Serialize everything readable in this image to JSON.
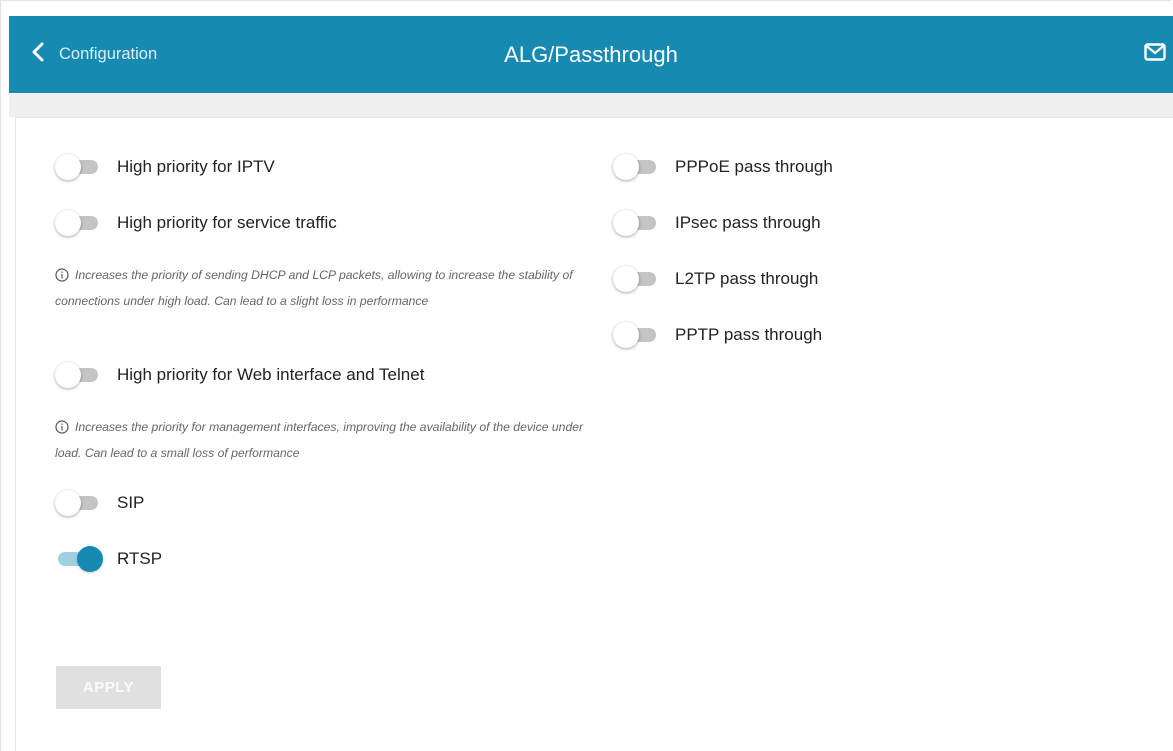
{
  "header": {
    "back_label": "Configuration",
    "title": "ALG/Passthrough",
    "mail_icon": "mail-icon",
    "back_icon": "chevron-left-icon",
    "color": "#178ab2"
  },
  "left_toggles": {
    "iptv": {
      "label": "High priority for IPTV",
      "on": false
    },
    "service": {
      "label": "High priority for service traffic",
      "on": false
    },
    "service_hint": "Increases the priority of sending DHCP and LCP packets, allowing to increase the stability of connections under high load. Can lead to a slight loss in performance",
    "web": {
      "label": "High priority for Web interface and Telnet",
      "on": false
    },
    "web_hint": "Increases the priority for management interfaces, improving the availability of the device under load. Can lead to a small loss of performance",
    "sip": {
      "label": "SIP",
      "on": false
    },
    "rtsp": {
      "label": "RTSP",
      "on": true
    }
  },
  "right_toggles": {
    "pppoe": {
      "label": "PPPoE pass through",
      "on": false
    },
    "ipsec": {
      "label": "IPsec pass through",
      "on": false
    },
    "l2tp": {
      "label": "L2TP pass through",
      "on": false
    },
    "pptp": {
      "label": "PPTP pass through",
      "on": false
    }
  },
  "apply_label": "APPLY",
  "colors": {
    "accent": "#178ab2",
    "toggle_on_track": "#9fd0e3",
    "toggle_off_track": "#c4c4c4",
    "apply_disabled": "#e0e0e0"
  }
}
